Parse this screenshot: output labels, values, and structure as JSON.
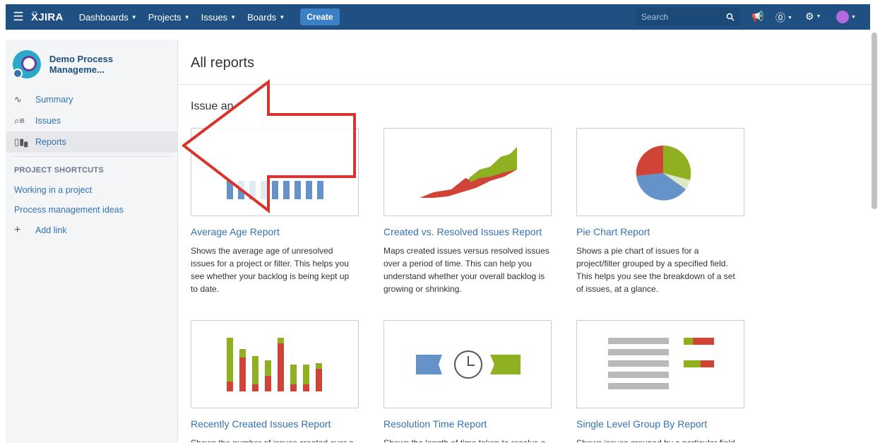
{
  "topbar": {
    "logo": "JIRA",
    "nav": [
      "Dashboards",
      "Projects",
      "Issues",
      "Boards"
    ],
    "create": "Create",
    "search_placeholder": "Search"
  },
  "sidebar": {
    "project_name": "Demo Process Manageme...",
    "items": [
      {
        "label": "Summary",
        "icon": "activity-icon"
      },
      {
        "label": "Issues",
        "icon": "issues-icon"
      },
      {
        "label": "Reports",
        "icon": "reports-icon"
      }
    ],
    "shortcuts_heading": "PROJECT SHORTCUTS",
    "shortcuts": [
      "Working in a project",
      "Process management ideas"
    ],
    "add_link": "Add link"
  },
  "main": {
    "title": "All reports",
    "section_title": "Issue an",
    "reports": [
      {
        "title": "Average Age Report",
        "desc": "Shows the average age of unresolved issues for a project or filter. This helps you see whether your backlog is being kept up to date."
      },
      {
        "title": "Created vs. Resolved Issues Report",
        "desc": "Maps created issues versus resolved issues over a period of time. This can help you understand whether your overall backlog is growing or shrinking."
      },
      {
        "title": "Pie Chart Report",
        "desc": "Shows a pie chart of issues for a project/filter grouped by a specified field. This helps you see the breakdown of a set of issues, at a glance."
      },
      {
        "title": "Recently Created Issues Report",
        "desc": "Shows the number of issues created over a"
      },
      {
        "title": "Resolution Time Report",
        "desc": "Shows the length of time taken to resolve a"
      },
      {
        "title": "Single Level Group By Report",
        "desc": "Shows issues grouped by a particular field"
      }
    ]
  },
  "colors": {
    "nav_bg": "#205081",
    "link": "#3572b0",
    "annotation_arrow": "#d9342b",
    "chart_red": "#d04437",
    "chart_green": "#8eb021",
    "chart_blue": "#6593c9"
  }
}
